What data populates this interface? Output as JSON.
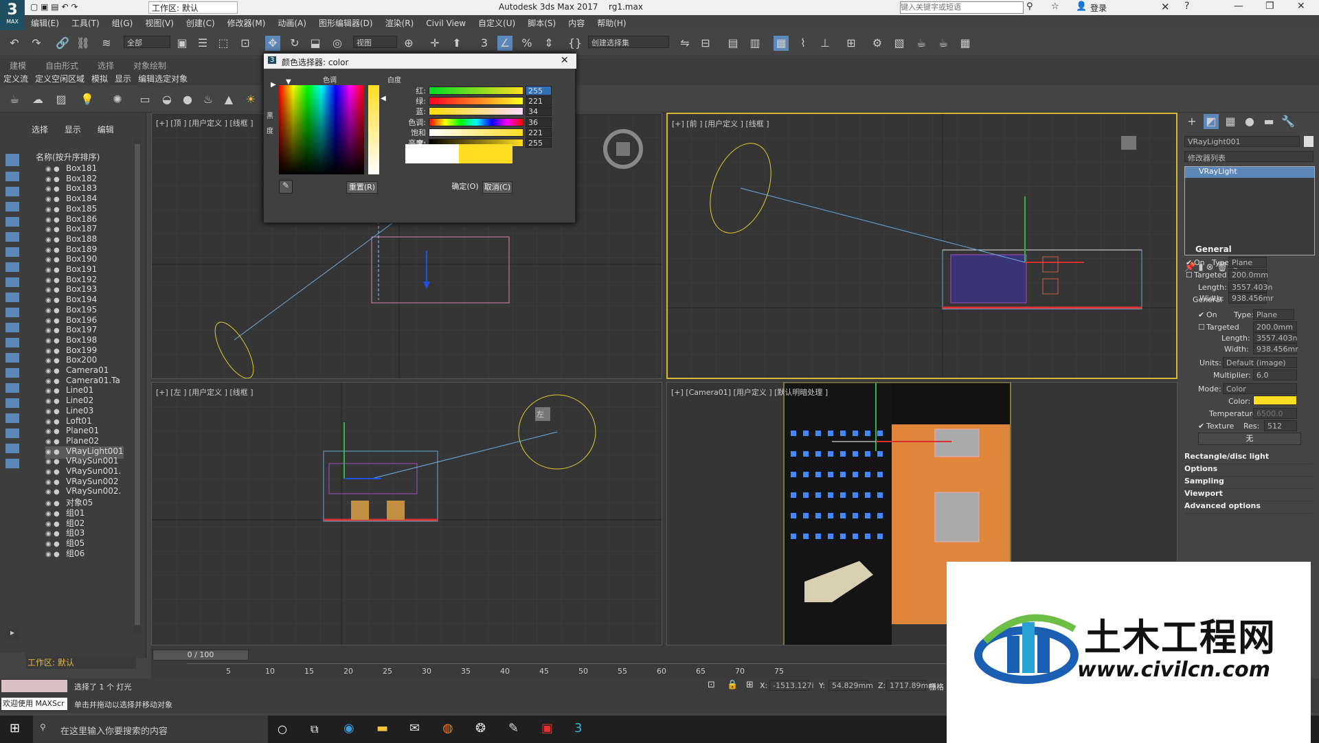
{
  "window": {
    "title": "Autodesk 3ds Max 2017",
    "filename": "rg1.max",
    "workspace_label": "工作区: 默认",
    "search_placeholder": "键入关键字或短语",
    "login": "登录",
    "logo_label": "MAX"
  },
  "menu": [
    "编辑(E)",
    "工具(T)",
    "组(G)",
    "视图(V)",
    "创建(C)",
    "修改器(M)",
    "动画(A)",
    "图形编辑器(D)",
    "渲染(R)",
    "Civil View",
    "自定义(U)",
    "脚本(S)",
    "内容",
    "帮助(H)"
  ],
  "toolbar": {
    "selection_filter": "全部",
    "ref_coord": "视图",
    "named_selection": "创建选择集"
  },
  "ribbon_tabs": [
    "建模",
    "自由形式",
    "选择",
    "对象绘制"
  ],
  "ribbon_subtabs": [
    "定义流",
    "定义空闲区域",
    "模拟",
    "显示",
    "编辑选定对象"
  ],
  "scene_explorer": {
    "tabs": [
      "选择",
      "显示",
      "编辑"
    ],
    "header": "名称(按升序排序)",
    "items": [
      "Box181",
      "Box182",
      "Box183",
      "Box184",
      "Box185",
      "Box186",
      "Box187",
      "Box188",
      "Box189",
      "Box190",
      "Box191",
      "Box192",
      "Box193",
      "Box194",
      "Box195",
      "Box196",
      "Box197",
      "Box198",
      "Box199",
      "Box200",
      "Camera01",
      "Camera01.Ta",
      "Line01",
      "Line02",
      "Line03",
      "Loft01",
      "Plane01",
      "Plane02",
      "VRayLight001",
      "VRaySun001",
      "VRaySun001.",
      "VRaySun002",
      "VRaySun002.",
      "对象05",
      "组01",
      "组02",
      "组03",
      "组05",
      "组06"
    ],
    "selected": "VRayLight001",
    "workspace": "工作区: 默认"
  },
  "viewports": {
    "top": "[+] [顶 ] [用户定义 ] [线框 ]",
    "front": "[+] [前 ] [用户定义 ] [线框 ]",
    "left": "[+] [左 ] [用户定义 ] [线框 ]",
    "camera": "[+] [Camera01] [用户定义 ] [默认明暗处理 ]",
    "viewcube_left": "左"
  },
  "color_dialog": {
    "title": "颜色选择器: color",
    "hue_label": "色调",
    "white_label": "白度",
    "black_label": "黑",
    "deg_label": "度",
    "rows": [
      {
        "label": "红:",
        "value": "255"
      },
      {
        "label": "绿:",
        "value": "221"
      },
      {
        "label": "蓝:",
        "value": "34"
      },
      {
        "label": "色调:",
        "value": "36"
      },
      {
        "label": "饱和度:",
        "value": "221"
      },
      {
        "label": "亮度:",
        "value": "255"
      }
    ],
    "reset": "重置(R)",
    "ok": "确定(O)",
    "cancel": "取消(C)",
    "old_color": "#ffffff",
    "new_color": "#ffdd22"
  },
  "command_panel": {
    "object_name": "VRayLight001",
    "modifier_list": "修改器列表",
    "stack_item": "VRayLight",
    "general": "General",
    "on": "On",
    "type_label": "Type:",
    "type_value": "Plane",
    "targeted": "Targeted",
    "targeted_value": "200.0mm",
    "length_label": "Length:",
    "length_value": "3557.403n",
    "width_label": "Width:",
    "width_value": "938.456mr",
    "units_label": "Units:",
    "units_value": "Default (image)",
    "multiplier_label": "Multiplier:",
    "multiplier_value": "6.0",
    "mode_label": "Mode:",
    "mode_value": "Color",
    "color_label": "Color:",
    "color_swatch": "#ffdd22",
    "temperature_label": "Temperature:",
    "temperature_value": "6500.0",
    "texture_label": "Texture",
    "res_label": "Res:",
    "res_value": "512",
    "none_btn": "无",
    "rollouts": [
      "Rectangle/disc light",
      "Options",
      "Sampling",
      "Viewport",
      "Advanced options"
    ]
  },
  "timeline": {
    "frame": "0 / 100",
    "ticks": [
      "5",
      "10",
      "15",
      "20",
      "25",
      "30",
      "35",
      "40",
      "45",
      "50",
      "55",
      "60",
      "65",
      "70",
      "75"
    ]
  },
  "status": {
    "welcome": "欢迎使用 MAXScr",
    "selected": "选择了 1 个 灯光",
    "hint": "单击并拖动以选择并移动对象",
    "x_label": "X:",
    "x_value": "-1513.127i",
    "y_label": "Y:",
    "y_value": "54.829mm",
    "z_label": "Z:",
    "z_value": "1717.89mm",
    "grid": "栅格"
  },
  "taskbar": {
    "search": "在这里输入你要搜索的内容"
  },
  "watermark": {
    "title": "土木工程网",
    "url": "www.civilcn.com"
  }
}
